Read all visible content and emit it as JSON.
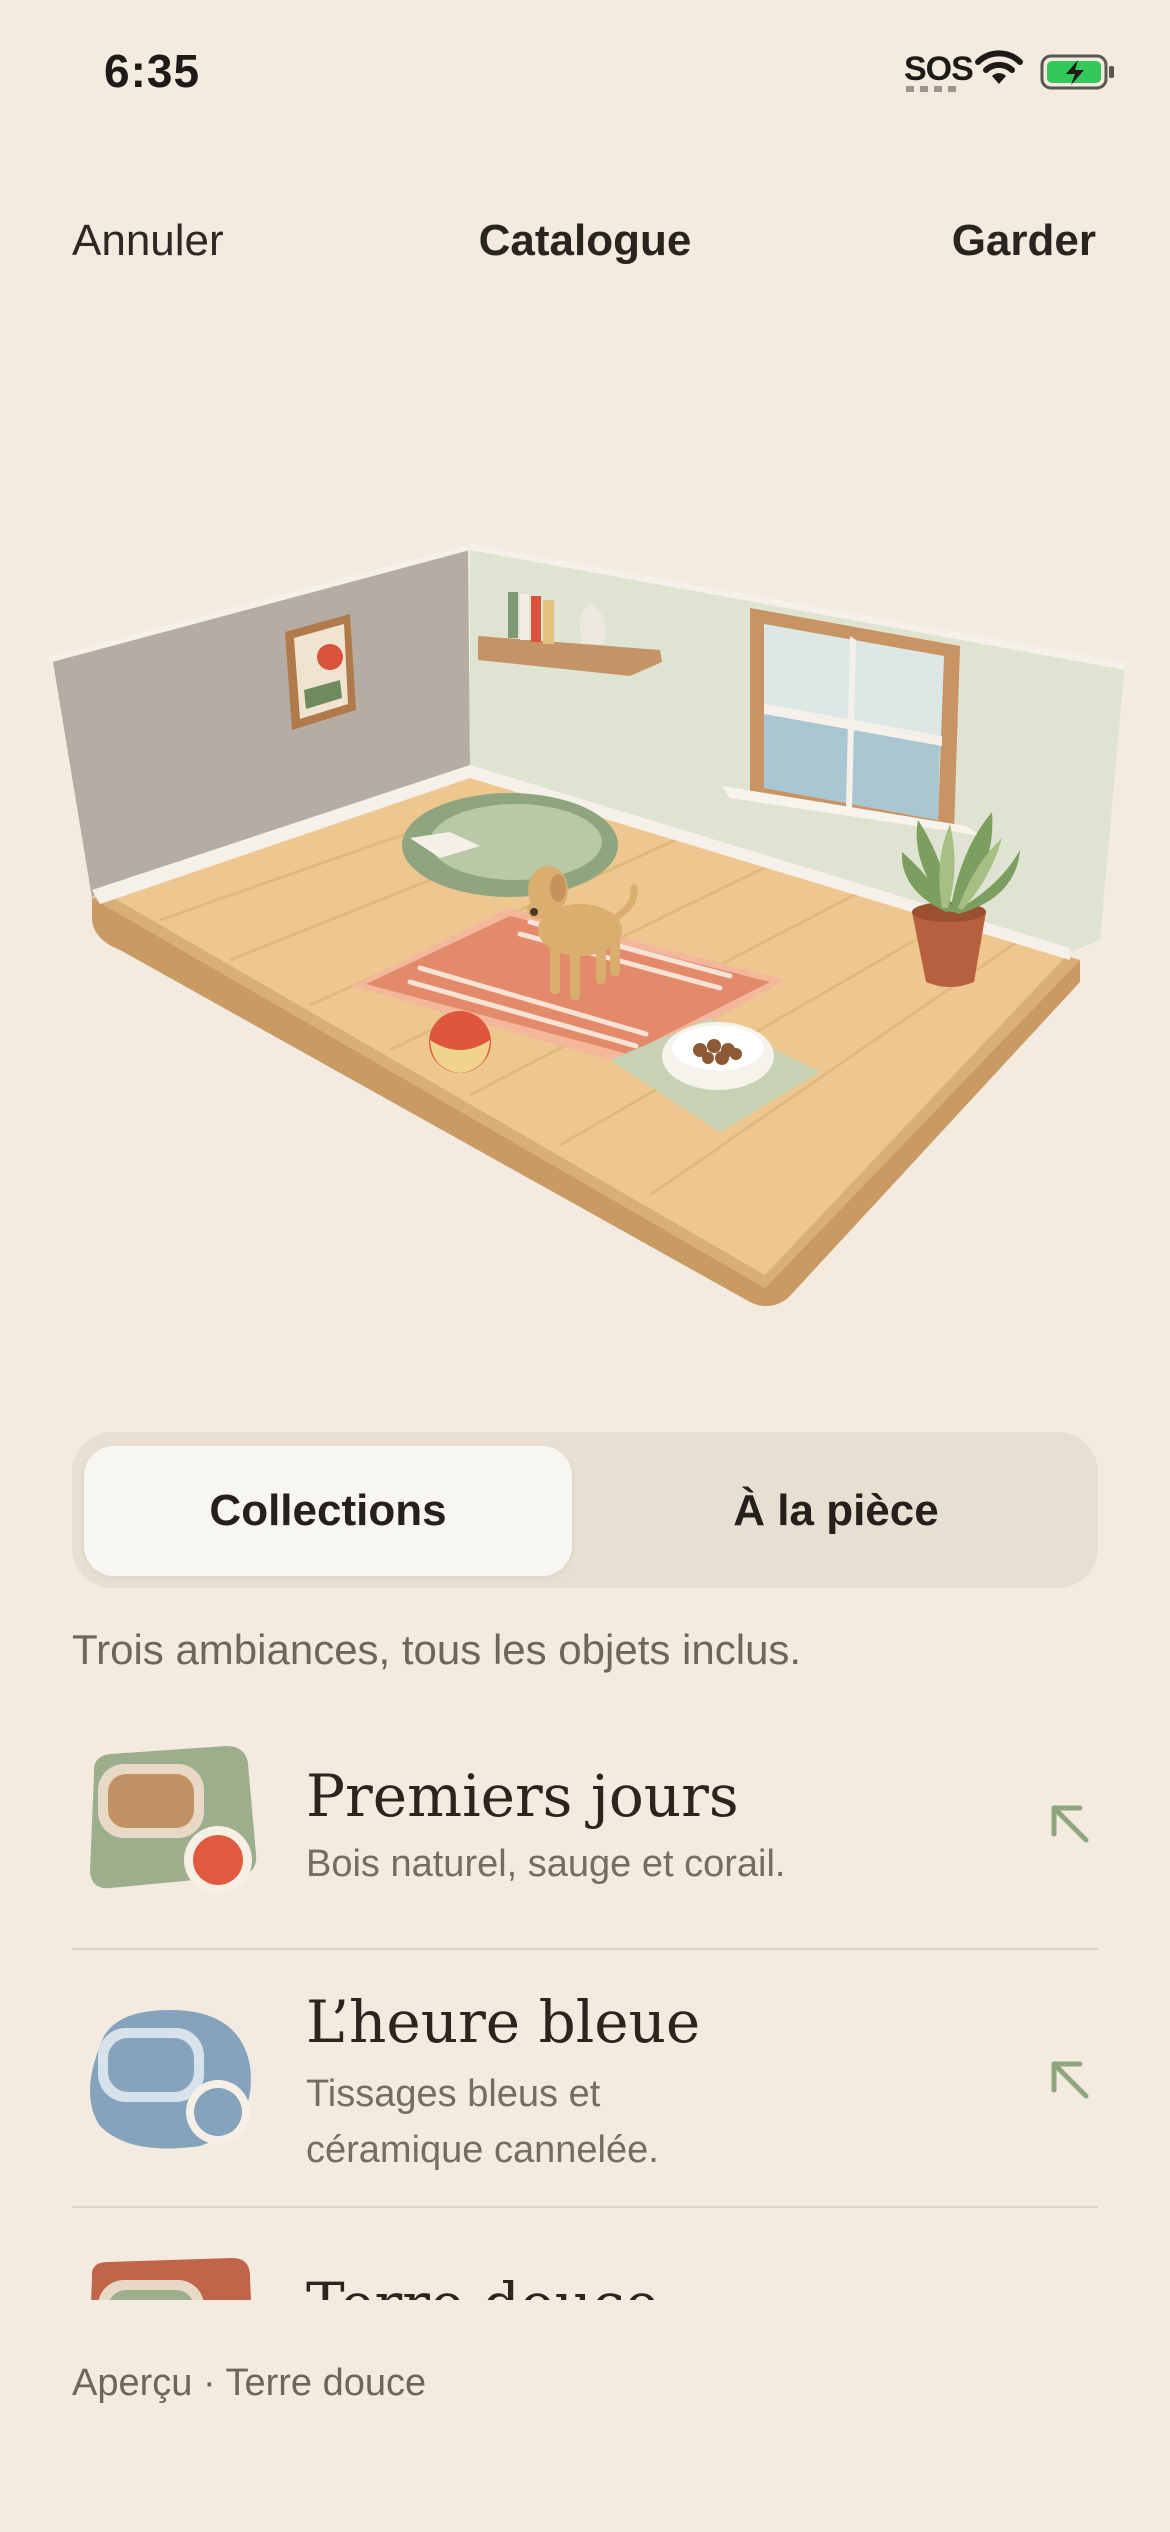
{
  "status": {
    "time": "6:35",
    "sos": "SOS"
  },
  "nav": {
    "cancel": "Annuler",
    "title": "Catalogue",
    "keep": "Garder"
  },
  "scene": {
    "description_icon": "room-3d-preview"
  },
  "segments": {
    "active": "Collections",
    "inactive": "À la pièce"
  },
  "subtitle": "Trois ambiances, tous les objets inclus.",
  "collections": [
    {
      "title": "Premiers jours",
      "desc": "Bois naturel, sauge et corail."
    },
    {
      "title": "L’heure bleue",
      "desc_line1": "Tissages bleus et",
      "desc_line2": "céramique cannelée."
    },
    {
      "title": "Terre douce"
    }
  ],
  "footer": {
    "preview": "Aperçu · Terre douce"
  },
  "colors": {
    "background": "#F3EBDF",
    "sage": "#9CAE8C",
    "coral": "#E05A40",
    "blue": "#85A3BC",
    "terracotta": "#C0654A"
  }
}
